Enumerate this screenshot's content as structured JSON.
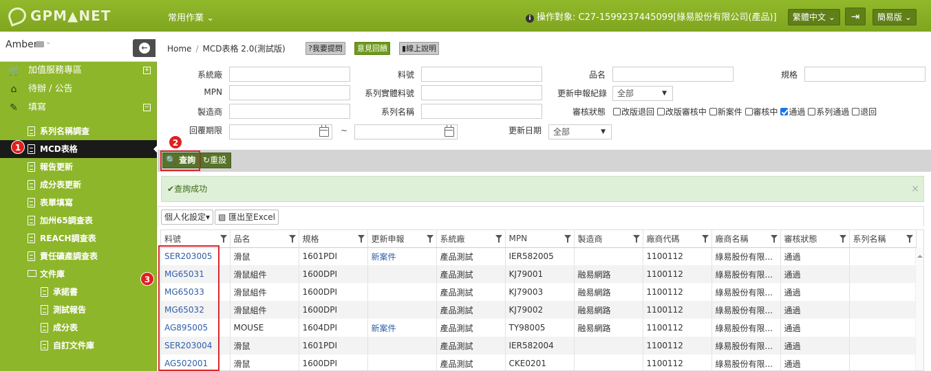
{
  "header": {
    "logo_text": "GPM▲NET",
    "menu_label": "常用作業",
    "operation_target": "操作對象: C27-1599237445099[綠易股份有限公司(產品)]",
    "language_label": "繁體中文",
    "mode_label": "簡易版"
  },
  "user": {
    "name": "Amber"
  },
  "sidebar": {
    "items": [
      {
        "label": "加值服務專區",
        "icon": "cart-icon"
      },
      {
        "label": "待辦 / 公告",
        "icon": "home-icon"
      },
      {
        "label": "填寫",
        "icon": "edit-icon"
      }
    ],
    "sub_items": [
      "系列名稱調查",
      "MCD表格",
      "報告更新",
      "成分表更新",
      "表單填寫",
      "加州65調查表",
      "REACH調查表",
      "責任礦產調查表",
      "文件庫"
    ],
    "doc_items": [
      "承諾書",
      "測試報告",
      "成分表",
      "自訂文件庫"
    ],
    "badges": [
      "1",
      "2",
      "3"
    ]
  },
  "breadcrumb": {
    "home": "Home",
    "current": "MCD表格 2.0(測試版)"
  },
  "header_buttons": {
    "ask": "?我要提問",
    "feedback": "意見回饋",
    "help": "線上說明"
  },
  "form": {
    "labels": {
      "system_factory": "系統廠",
      "part_no": "料號",
      "product_name": "品名",
      "spec": "規格",
      "mpn": "MPN",
      "series_part": "系列實體料號",
      "update_record": "更新申報紀錄",
      "manufacturer": "製造商",
      "series_name": "系列名稱",
      "review_status": "審核狀態",
      "return_period": "回覆期限",
      "update_date": "更新日期"
    },
    "select_all": "全部",
    "tilde": "~",
    "status_options": [
      {
        "label": "改版退回",
        "checked": false
      },
      {
        "label": "改版審核中",
        "checked": false
      },
      {
        "label": "新案件",
        "checked": false
      },
      {
        "label": "審核中",
        "checked": false
      },
      {
        "label": "通過",
        "checked": true
      },
      {
        "label": "系列通過",
        "checked": false
      },
      {
        "label": "退回",
        "checked": false
      }
    ]
  },
  "actions": {
    "query": "查詢",
    "reset": "重設"
  },
  "alert": {
    "message": "查詢成功"
  },
  "grid_toolbar": {
    "personalize": "個人化設定",
    "export": "匯出至Excel"
  },
  "table": {
    "columns": [
      "料號",
      "品名",
      "規格",
      "更新申報",
      "系統廠",
      "MPN",
      "製造商",
      "廠商代碼",
      "廠商名稱",
      "審核狀態",
      "系列名稱"
    ],
    "rows": [
      [
        "SER203005",
        "滑鼠",
        "1601PDI",
        "新案件",
        "產品測試",
        "IER582005",
        "",
        "1100112",
        "綠易股份有限...",
        "通過",
        ""
      ],
      [
        "MG65031",
        "滑鼠組件",
        "1600DPI",
        "",
        "產品測試",
        "KJ79001",
        "融易網路",
        "1100112",
        "綠易股份有限...",
        "通過",
        ""
      ],
      [
        "MG65033",
        "滑鼠組件",
        "1600DPI",
        "",
        "產品測試",
        "KJ79003",
        "融易網路",
        "1100112",
        "綠易股份有限...",
        "通過",
        ""
      ],
      [
        "MG65032",
        "滑鼠組件",
        "1600DPI",
        "",
        "產品測試",
        "KJ79002",
        "融易網路",
        "1100112",
        "綠易股份有限...",
        "通過",
        ""
      ],
      [
        "AG895005",
        "MOUSE",
        "1604DPI",
        "新案件",
        "產品測試",
        "TY98005",
        "融易網路",
        "1100112",
        "綠易股份有限...",
        "通過",
        ""
      ],
      [
        "SER203004",
        "滑鼠",
        "1601PDI",
        "",
        "產品測試",
        "IER582004",
        "",
        "1100112",
        "綠易股份有限...",
        "通過",
        ""
      ],
      [
        "AG502001",
        "滑鼠",
        "1600DPI",
        "",
        "產品測試",
        "CKE0201",
        "",
        "1100112",
        "綠易股份有限...",
        "通過",
        ""
      ]
    ]
  },
  "colors": {
    "brand": "#8db62a",
    "active": "#1a1a1a",
    "badge": "#e02020",
    "link": "#2f5ea8"
  }
}
